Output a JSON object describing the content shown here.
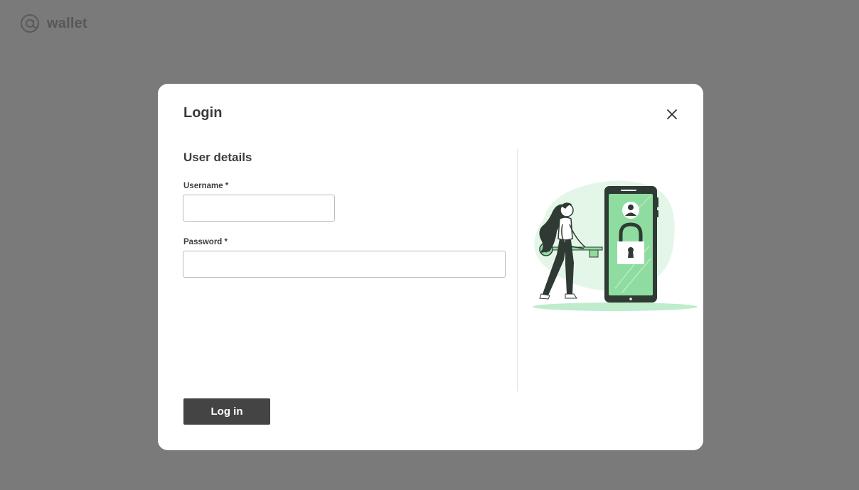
{
  "brand": {
    "name": "wallet",
    "icon": "at-sign-icon"
  },
  "modal": {
    "title": "Login",
    "close_icon": "close-icon",
    "section_title": "User details",
    "fields": {
      "username": {
        "label": "Username *",
        "value": ""
      },
      "password": {
        "label": "Password *",
        "value": ""
      }
    },
    "submit_label": "Log in",
    "illustration": "woman-with-key-unlocking-phone-illustration"
  },
  "colors": {
    "backdrop": "#7a7a7a",
    "modal_bg": "#ffffff",
    "primary_button": "#444444",
    "illustration_accent": "#8fdca1",
    "illustration_light": "#e4f6e8"
  }
}
